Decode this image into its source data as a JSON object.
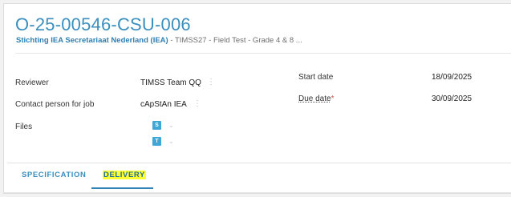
{
  "header": {
    "title": "O-25-00546-CSU-006",
    "client": "Stichting IEA Secretariaat Nederland (IEA)",
    "subtitle_rest": " - TIMSS27 - Field Test - Grade 4 & 8 ..."
  },
  "details": {
    "reviewer_label": "Reviewer",
    "reviewer_value": "TIMSS Team QQ",
    "contact_label": "Contact person for job",
    "contact_value": "cApStAn IEA",
    "files_label": "Files",
    "files": [
      {
        "badge": "S"
      },
      {
        "badge": "T"
      }
    ],
    "start_label": "Start date",
    "start_value": "18/09/2025",
    "due_label": "Due date",
    "due_required": "*",
    "due_value": "30/09/2025"
  },
  "tabs": [
    {
      "label": "SPECIFICATION",
      "active": false
    },
    {
      "label": "DELIVERY",
      "active": true
    }
  ],
  "colors": {
    "accent": "#3a8fbf",
    "file_icon": "#3fa7d6",
    "highlight": "#ffff33"
  }
}
